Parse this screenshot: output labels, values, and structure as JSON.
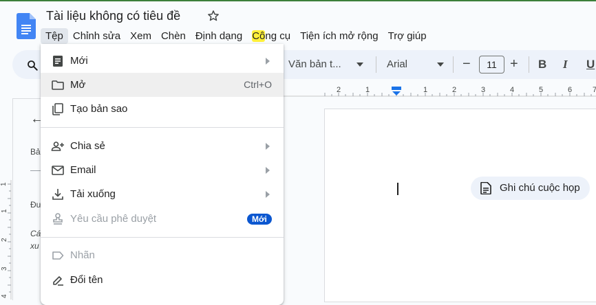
{
  "document": {
    "title": "Tài liệu không có tiêu đề"
  },
  "menubar": {
    "items": [
      "Tệp",
      "Chỉnh sửa",
      "Xem",
      "Chèn",
      "Định dạng",
      "Công cụ",
      "Tiện ích mở rộng",
      "Trợ giúp"
    ],
    "tools_part1": "Cô",
    "tools_part2": "ng cụ"
  },
  "toolbar": {
    "style": "Văn bản t...",
    "font": "Arial",
    "font_size": "11",
    "minus": "−",
    "plus": "+",
    "bold": "B",
    "italic": "I",
    "underline": "U"
  },
  "ruler": {
    "ticks": [
      "2",
      "1",
      "1",
      "2",
      "3",
      "4",
      "5",
      "6",
      "7"
    ],
    "vticks": [
      "1",
      "1",
      "2",
      "3",
      "4"
    ]
  },
  "left_panel": {
    "back": "←",
    "t1": "Bả",
    "t2": "Đư",
    "t3": "Cá",
    "t4": "xu"
  },
  "chip": {
    "label": "Ghi chú cuộc họp"
  },
  "file_menu": {
    "new": "Mới",
    "open": "Mở",
    "open_shortcut": "Ctrl+O",
    "copy": "Tạo bản sao",
    "share": "Chia sẻ",
    "email": "Email",
    "download": "Tải xuống",
    "approval": "Yêu cầu phê duyệt",
    "approval_badge": "Mới",
    "label": "Nhãn",
    "rename": "Đổi tên"
  },
  "colors": {
    "accent": "#0b57d0",
    "toolbar_bg": "#edf2fa",
    "highlight": "#fff03a"
  }
}
